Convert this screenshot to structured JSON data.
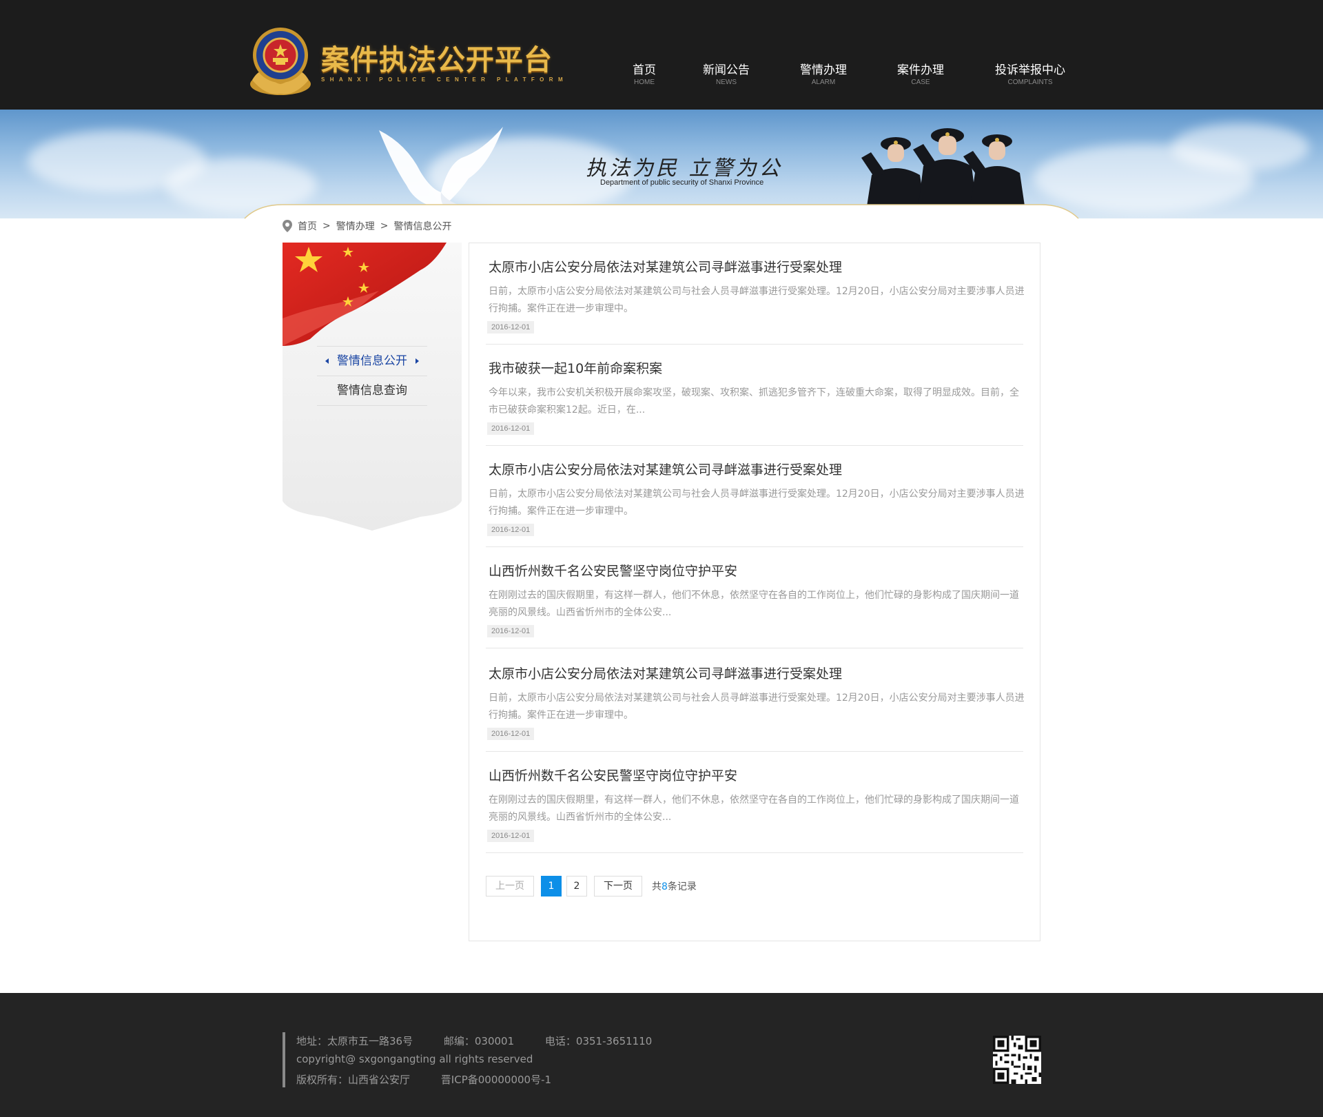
{
  "header": {
    "logo_title": "案件执法公开平台",
    "logo_subtitle": "SHANXI POLICE CENTER PLATFORM",
    "nav": [
      {
        "label": "首页",
        "en": "HOME"
      },
      {
        "label": "新闻公告",
        "en": "NEWS"
      },
      {
        "label": "警情办理",
        "en": "ALARM"
      },
      {
        "label": "案件办理",
        "en": "CASE"
      },
      {
        "label": "投诉举报中心",
        "en": "COMPLAINTS"
      }
    ]
  },
  "banner": {
    "slogan": "执法为民  立警为公",
    "subtitle": "Department of public security of Shanxi Province"
  },
  "breadcrumb": {
    "items": [
      "首页",
      "警情办理",
      "警情信息公开"
    ],
    "separator": ">"
  },
  "sidebar": {
    "items": [
      {
        "label": "警情信息公开",
        "active": true
      },
      {
        "label": "警情信息查询",
        "active": false
      }
    ],
    "active_color": "#1a45a3"
  },
  "articles": [
    {
      "title": "太原市小店公安分局依法对某建筑公司寻衅滋事进行受案处理",
      "summary": "日前，太原市小店公安分局依法对某建筑公司与社会人员寻衅滋事进行受案处理。12月20日，小店公安分局对主要涉事人员进行拘捕。案件正在进一步审理中。",
      "date": "2016-12-01"
    },
    {
      "title": "我市破获一起10年前命案积案",
      "summary": "今年以来，我市公安机关积极开展命案攻坚，破现案、攻积案、抓逃犯多管齐下，连破重大命案，取得了明显成效。目前，全市已破获命案积案12起。近日，在...",
      "date": "2016-12-01"
    },
    {
      "title": "太原市小店公安分局依法对某建筑公司寻衅滋事进行受案处理",
      "summary": "日前，太原市小店公安分局依法对某建筑公司与社会人员寻衅滋事进行受案处理。12月20日，小店公安分局对主要涉事人员进行拘捕。案件正在进一步审理中。",
      "date": "2016-12-01"
    },
    {
      "title": "山西忻州数千名公安民警坚守岗位守护平安",
      "summary": "在刚刚过去的国庆假期里，有这样一群人，他们不休息，依然坚守在各自的工作岗位上，他们忙碌的身影构成了国庆期间一道亮丽的风景线。山西省忻州市的全体公安...",
      "date": "2016-12-01"
    },
    {
      "title": "太原市小店公安分局依法对某建筑公司寻衅滋事进行受案处理",
      "summary": "日前，太原市小店公安分局依法对某建筑公司与社会人员寻衅滋事进行受案处理。12月20日，小店公安分局对主要涉事人员进行拘捕。案件正在进一步审理中。",
      "date": "2016-12-01"
    },
    {
      "title": "山西忻州数千名公安民警坚守岗位守护平安",
      "summary": "在刚刚过去的国庆假期里，有这样一群人，他们不休息，依然坚守在各自的工作岗位上，他们忙碌的身影构成了国庆期间一道亮丽的风景线。山西省忻州市的全体公安...",
      "date": "2016-12-01"
    }
  ],
  "pager": {
    "prev": "上一页",
    "pages": [
      "1",
      "2"
    ],
    "current": "1",
    "next": "下一页",
    "total_prefix": "共",
    "total_count": "8",
    "total_suffix": "条记录",
    "accent": "#0d8fe8"
  },
  "footer": {
    "address": "地址：太原市五一路36号",
    "postcode": "邮编：030001",
    "phone": "电话：0351-3651110",
    "copyright": "copyright@ sxgongangting all rights reserved",
    "owner": "版权所有：山西省公安厅",
    "icp": "晋ICP备00000000号-1"
  },
  "colors": {
    "header_bg": "#1c1c1c",
    "footer_bg": "#242424",
    "logo_gold": "#e9b94a"
  }
}
